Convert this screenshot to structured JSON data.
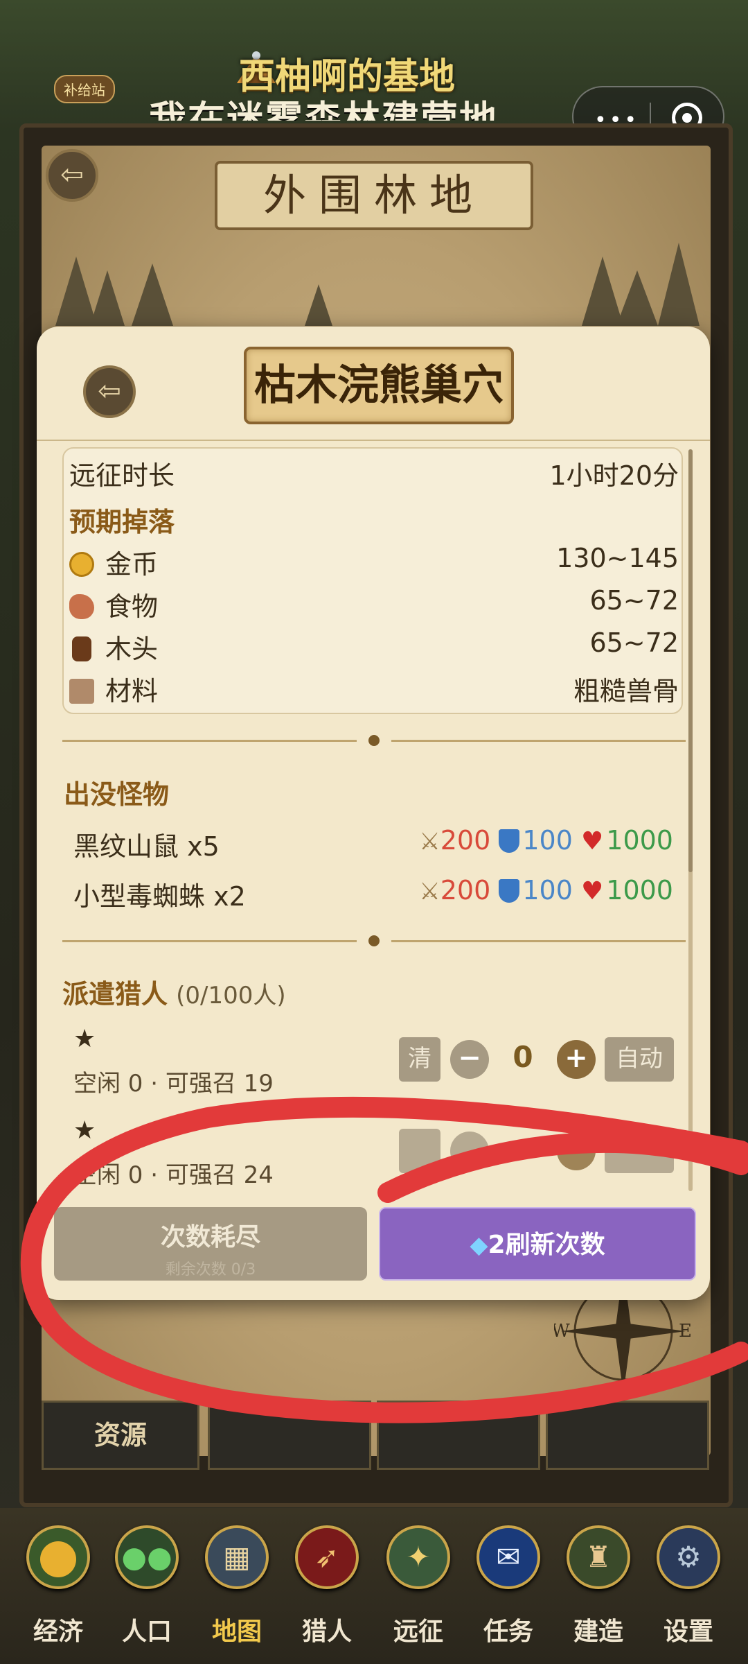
{
  "header": {
    "title": "西柚啊的基地",
    "subtitle": "我在迷雾森林建营地",
    "supply_badge": "补给站"
  },
  "map": {
    "title": "外围林地",
    "tabs": [
      "资源",
      "",
      "",
      ""
    ]
  },
  "modal": {
    "title": "枯木浣熊巢穴",
    "expedition_label": "远征时长",
    "expedition_value": "1小时20分",
    "drops_label": "预期掉落",
    "drops": [
      {
        "icon": "coin-icon",
        "name": "金币",
        "value": "130~145"
      },
      {
        "icon": "meat-icon",
        "name": "食物",
        "value": "65~72"
      },
      {
        "icon": "log-icon",
        "name": "木头",
        "value": "65~72"
      },
      {
        "icon": "crate-icon",
        "name": "材料",
        "value": "粗糙兽骨"
      }
    ],
    "monsters_label": "出没怪物",
    "monsters": [
      {
        "name": "黑纹山鼠 x5",
        "atk": "200",
        "def": "100",
        "hp": "1000"
      },
      {
        "name": "小型毒蜘蛛 x2",
        "atk": "200",
        "def": "100",
        "hp": "1000"
      }
    ],
    "dispatch_label": "派遣猎人",
    "dispatch_count": "(0/100人)",
    "hunters": [
      {
        "stars": "★",
        "status": "空闲 0 · 可强召 19",
        "clear": "清",
        "count": "0",
        "auto": "自动"
      },
      {
        "stars": "★",
        "status": "空闲 0 · 可强召 24"
      }
    ],
    "btn_exhausted": "次数耗尽",
    "btn_exhausted_sub": "剩余次数 0/3",
    "btn_refresh": "2刷新次数"
  },
  "nav": [
    {
      "icon": "coin-icon",
      "label": "经济"
    },
    {
      "icon": "people-icon",
      "label": "人口"
    },
    {
      "icon": "map-icon",
      "label": "地图"
    },
    {
      "icon": "bow-icon",
      "label": "猎人"
    },
    {
      "icon": "compass-icon",
      "label": "远征"
    },
    {
      "icon": "scroll-icon",
      "label": "任务"
    },
    {
      "icon": "castle-icon",
      "label": "建造"
    },
    {
      "icon": "gear-icon",
      "label": "设置"
    }
  ],
  "colors": {
    "modal_bg": "#f3e8cb",
    "accent_purple": "#8a64c0",
    "attack": "#d84a3a",
    "defense": "#4a86c8",
    "hp": "#3c9a4a",
    "annotation_red": "#e23a3a",
    "nav_active": "#f2c94c"
  }
}
